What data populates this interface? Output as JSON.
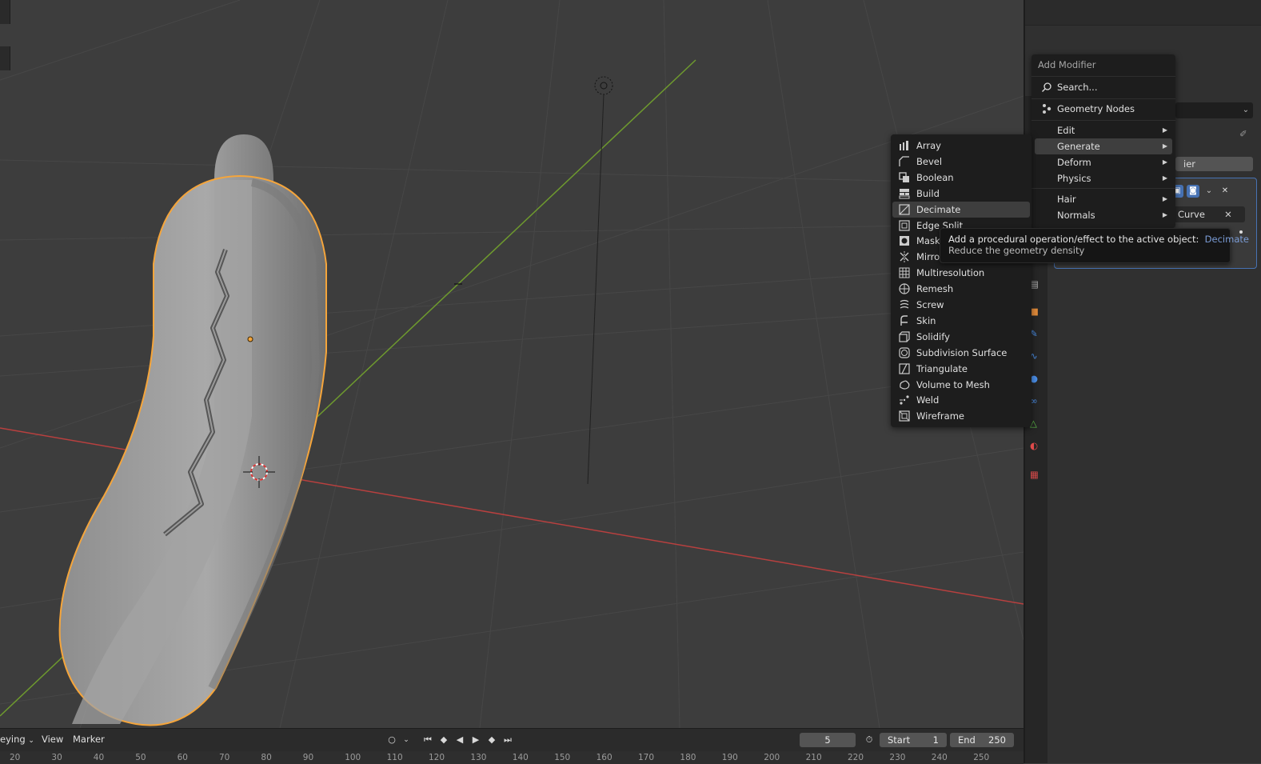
{
  "add_modifier_menu": {
    "title": "Add Modifier",
    "search_label": "Search...",
    "geometry_nodes_label": "Geometry Nodes",
    "categories": [
      {
        "label": "Edit"
      },
      {
        "label": "Generate"
      },
      {
        "label": "Deform"
      },
      {
        "label": "Physics"
      },
      {
        "label": "Hair"
      },
      {
        "label": "Normals"
      }
    ]
  },
  "generate_menu": {
    "items": [
      {
        "label": "Array",
        "icon": "array-icon"
      },
      {
        "label": "Bevel",
        "icon": "bevel-icon"
      },
      {
        "label": "Boolean",
        "icon": "boolean-icon"
      },
      {
        "label": "Build",
        "icon": "build-icon"
      },
      {
        "label": "Decimate",
        "icon": "decimate-icon"
      },
      {
        "label": "Edge Split",
        "icon": "edge-split-icon"
      },
      {
        "label": "Mask",
        "icon": "mask-icon"
      },
      {
        "label": "Mirror",
        "icon": "mirror-icon"
      },
      {
        "label": "Multiresolution",
        "icon": "multiresolution-icon"
      },
      {
        "label": "Remesh",
        "icon": "remesh-icon"
      },
      {
        "label": "Screw",
        "icon": "screw-icon"
      },
      {
        "label": "Skin",
        "icon": "skin-icon"
      },
      {
        "label": "Solidify",
        "icon": "solidify-icon"
      },
      {
        "label": "Subdivision Surface",
        "icon": "subdivision-surface-icon"
      },
      {
        "label": "Triangulate",
        "icon": "triangulate-icon"
      },
      {
        "label": "Volume to Mesh",
        "icon": "volume-to-mesh-icon"
      },
      {
        "label": "Weld",
        "icon": "weld-icon"
      },
      {
        "label": "Wireframe",
        "icon": "wireframe-icon"
      }
    ]
  },
  "tooltip": {
    "line1": "Add a procedural operation/effect to the active object:",
    "highlight": "Decimate",
    "line2": "Reduce the geometry density"
  },
  "properties": {
    "add_modifier_partial": "ier",
    "curve_field_partial": "Curve"
  },
  "timeline": {
    "mode_partial": "eying",
    "view_label": "View",
    "marker_label": "Marker",
    "current_frame": "5",
    "start_label": "Start",
    "start_value": "1",
    "end_label": "End",
    "end_value": "250",
    "ruler": [
      "20",
      "30",
      "40",
      "50",
      "60",
      "70",
      "80",
      "90",
      "100",
      "110",
      "120",
      "130",
      "140",
      "150",
      "160",
      "170",
      "180",
      "190",
      "200",
      "210",
      "220",
      "230",
      "240",
      "250"
    ]
  },
  "colors": {
    "selection_outline": "#f5a53b",
    "x_axis": "#b8403f",
    "y_axis": "#6e9a2e",
    "highlight_blue": "#4772b3"
  }
}
